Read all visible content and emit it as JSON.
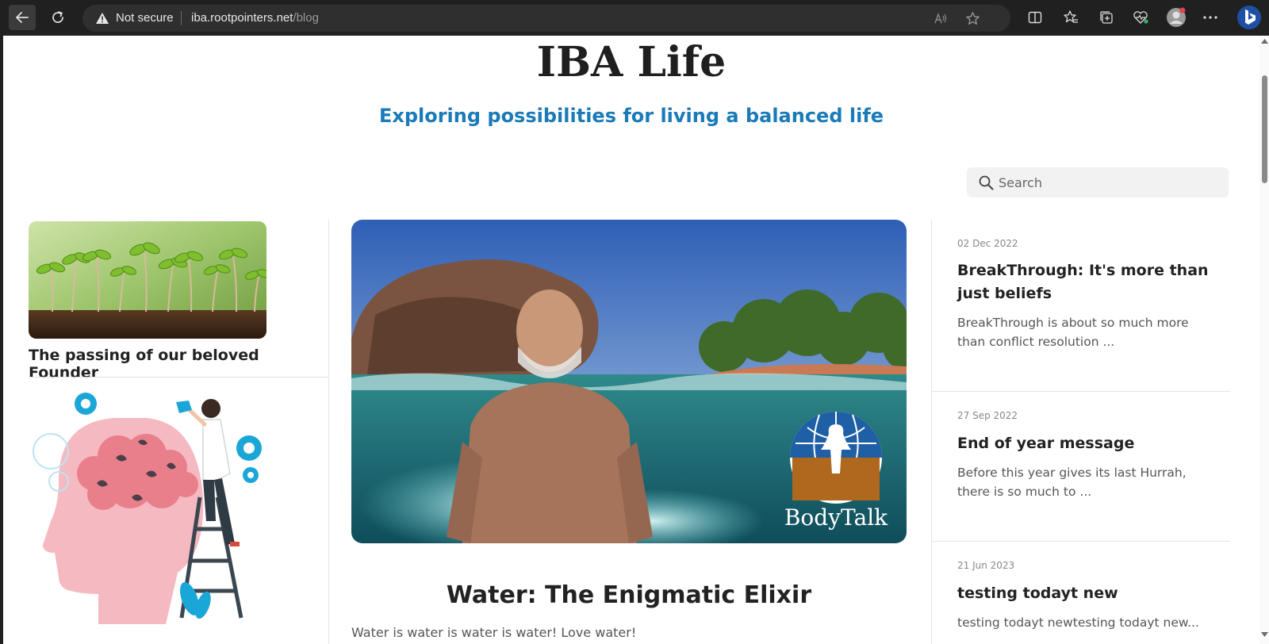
{
  "browser": {
    "security_label": "Not secure",
    "url_host": "iba.rootpointers.net",
    "url_path": "/blog"
  },
  "site": {
    "title": "IBA Life",
    "tagline": "Exploring possibilities for living a balanced life"
  },
  "search": {
    "placeholder": "Search"
  },
  "left_column": {
    "post_title": "The passing of our beloved Founder"
  },
  "featured": {
    "title": "Water: The Enigmatic Elixir",
    "excerpt": "Water is water is water is water! Love water!",
    "logo_text": "BodyTalk"
  },
  "recent_posts": [
    {
      "date": "02 Dec 2022",
      "title": "BreakThrough: It's more than just beliefs",
      "excerpt": "BreakThrough is about so much more than conflict resolution ..."
    },
    {
      "date": "27 Sep 2022",
      "title": "End of year message",
      "excerpt": "Before this year gives its last Hurrah, there is so much to ..."
    },
    {
      "date": "21 Jun 2023",
      "title": "testing todayt new",
      "excerpt": "testing todayt newtesting todayt new..."
    }
  ],
  "colors": {
    "accent": "#1a7bb8",
    "chrome_bg": "#202020"
  }
}
